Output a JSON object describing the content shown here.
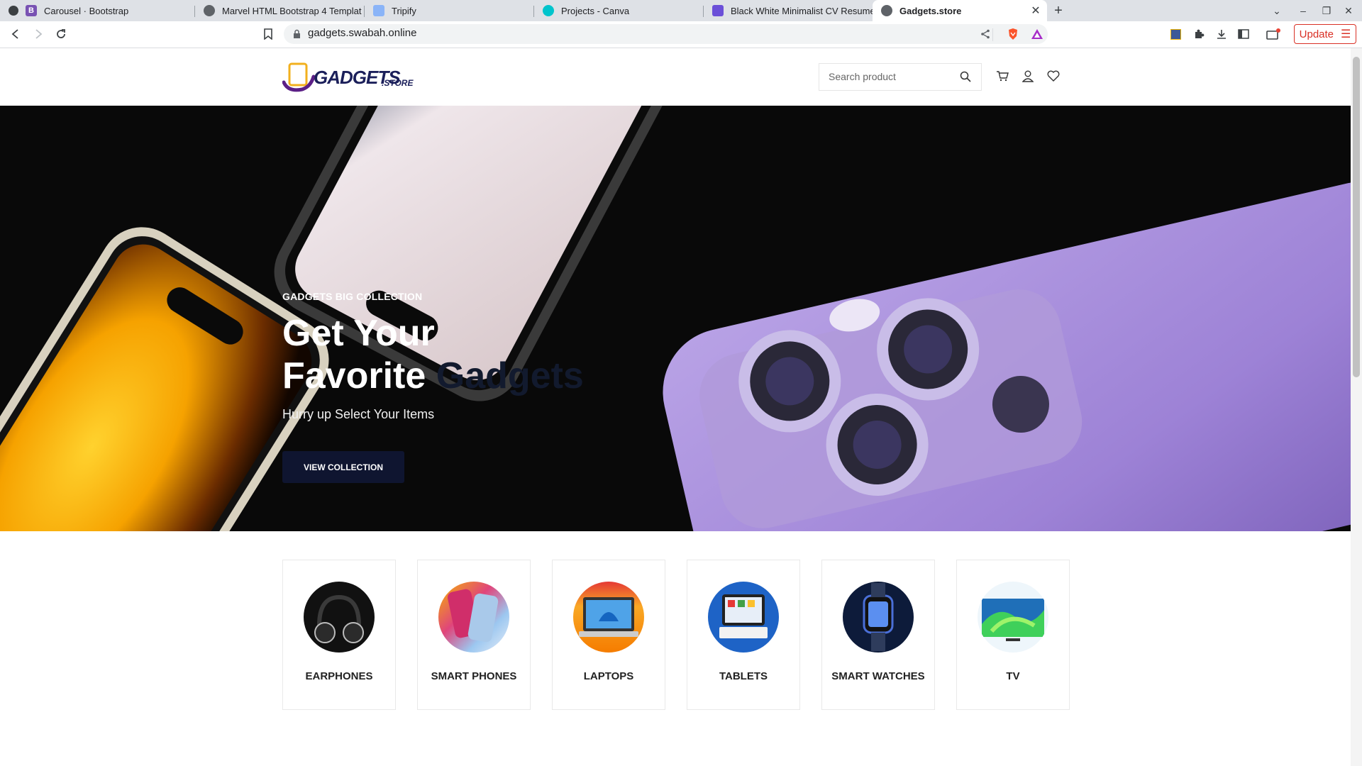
{
  "browser": {
    "tabs": [
      {
        "title": "Carousel · Bootstrap",
        "icon": "bootstrap-icon",
        "active": false
      },
      {
        "title": "Marvel HTML Bootstrap 4 Templat",
        "icon": "globe-icon",
        "active": false
      },
      {
        "title": "Tripify",
        "icon": "tripify-icon",
        "active": false
      },
      {
        "title": "Projects - Canva",
        "icon": "canva-icon",
        "active": false
      },
      {
        "title": "Black White Minimalist CV Resume",
        "icon": "canva-doc-icon",
        "active": false
      },
      {
        "title": "Gadgets.store",
        "icon": "globe-icon",
        "active": true
      }
    ],
    "url": "gadgets.swabah.online",
    "update_label": "Update"
  },
  "site": {
    "logo_text": "GADGETS",
    "logo_suffix": ".STORE",
    "search_placeholder": "Search product"
  },
  "hero": {
    "kicker": "GADGETS BIG COLLECTION",
    "title_line1": "Get Your",
    "title_line2_a": "Favorite",
    "title_line2_b": "Gadgets",
    "subtitle": "Hurry up Select Your Items",
    "button": "VIEW COLLECTION"
  },
  "categories": [
    {
      "label": "EARPHONES"
    },
    {
      "label": "SMART PHONES"
    },
    {
      "label": "LAPTOPS"
    },
    {
      "label": "TABLETS"
    },
    {
      "label": "SMART WATCHES"
    },
    {
      "label": "TV"
    }
  ],
  "colors": {
    "accent": "#0f1530",
    "update": "#d93025",
    "logo_purple": "#5b1f86"
  }
}
